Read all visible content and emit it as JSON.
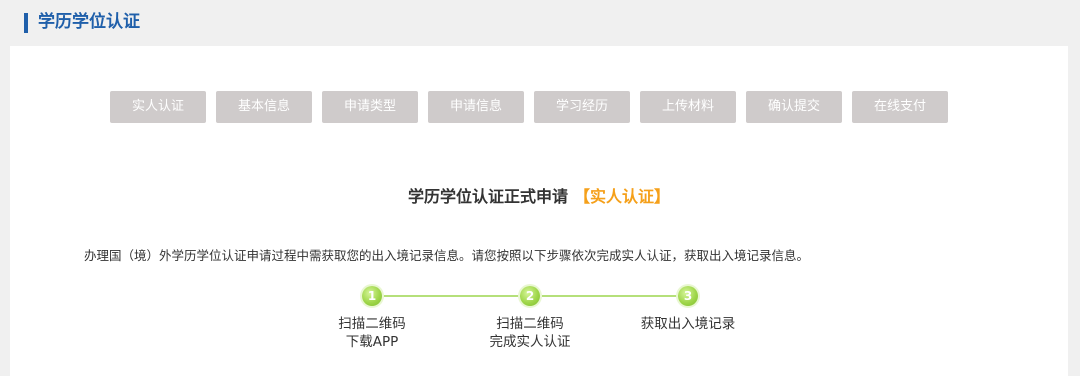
{
  "header": {
    "title": "学历学位认证"
  },
  "steps": [
    "实人认证",
    "基本信息",
    "申请类型",
    "申请信息",
    "学习经历",
    "上传材料",
    "确认提交",
    "在线支付"
  ],
  "main": {
    "title": "学历学位认证正式申请",
    "badge": "【实人认证】",
    "intro": "办理国（境）外学历学位认证申请过程中需获取您的出入境记录信息。请您按照以下步骤依次完成实人认证，获取出入境记录信息。"
  },
  "flow": [
    {
      "number": "1",
      "line1": "扫描二维码",
      "line2": "下载APP"
    },
    {
      "number": "2",
      "line1": "扫描二维码",
      "line2": "完成实人认证"
    },
    {
      "number": "3",
      "line1": "获取出入境记录",
      "line2": ""
    }
  ],
  "colors": {
    "accent": "#1f5faa",
    "badge": "#f5a01a",
    "step_button": "#cfcbcb",
    "flow_green": "#9fd64a"
  }
}
